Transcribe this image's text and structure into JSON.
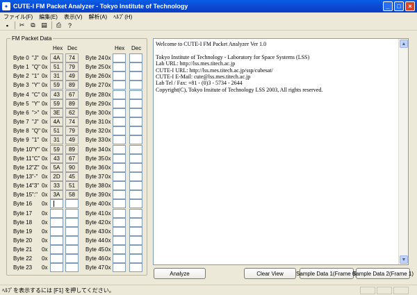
{
  "window": {
    "title": "CUTE-I FM Packet Analyzer - Tokyo Institute of Technology",
    "app_icon": "satellite-icon",
    "minimize": "_",
    "maximize": "□",
    "close": "×"
  },
  "menu": [
    "ファイル(F)",
    "編集(E)",
    "表示(V)",
    "解析(A)",
    "ﾍﾙﾌﾟ(H)"
  ],
  "toolbar": {
    "icons": [
      "save-icon",
      "cut-icon",
      "copy-icon",
      "paste-icon",
      "print-icon",
      "help-icon"
    ],
    "glyphs": [
      "▪",
      "✂",
      "⧉",
      "▤",
      "⎙",
      "?"
    ]
  },
  "packet_group": {
    "label": "FM Packet Data",
    "hex_header": "Hex",
    "dec_header": "Dec",
    "ox": "0x",
    "left_rows": [
      {
        "label": "Byte 0",
        "ch": "\"J\"",
        "hex": "4A",
        "dec": "74"
      },
      {
        "label": "Byte 1",
        "ch": "\"Q\"",
        "hex": "51",
        "dec": "79"
      },
      {
        "label": "Byte 2",
        "ch": "\"1\"",
        "hex": "31",
        "dec": "49"
      },
      {
        "label": "Byte 3",
        "ch": "\"Y\"",
        "hex": "59",
        "dec": "89"
      },
      {
        "label": "Byte 4",
        "ch": "\"C\"",
        "hex": "43",
        "dec": "67"
      },
      {
        "label": "Byte 5",
        "ch": "\"Y\"",
        "hex": "59",
        "dec": "89"
      },
      {
        "label": "Byte 6",
        "ch": "\">\"",
        "hex": "3E",
        "dec": "62"
      },
      {
        "label": "Byte 7",
        "ch": "\"J\"",
        "hex": "4A",
        "dec": "74"
      },
      {
        "label": "Byte 8",
        "ch": "\"Q\"",
        "hex": "51",
        "dec": "79"
      },
      {
        "label": "Byte 9",
        "ch": "\"1\"",
        "hex": "31",
        "dec": "49"
      },
      {
        "label": "Byte 10",
        "ch": "\"Y\"",
        "hex": "59",
        "dec": "89"
      },
      {
        "label": "Byte 11",
        "ch": "\"C\"",
        "hex": "43",
        "dec": "67"
      },
      {
        "label": "Byte 12",
        "ch": "\"Z\"",
        "hex": "5A",
        "dec": "90"
      },
      {
        "label": "Byte 13",
        "ch": "\"-\"",
        "hex": "2D",
        "dec": "45"
      },
      {
        "label": "Byte 14",
        "ch": "\"3\"",
        "hex": "33",
        "dec": "51"
      },
      {
        "label": "Byte 15",
        "ch": "\":\"",
        "hex": "3A",
        "dec": "58"
      },
      {
        "label": "Byte 16",
        "ch": "",
        "hex": "",
        "dec": ""
      },
      {
        "label": "Byte 17",
        "ch": "",
        "hex": "",
        "dec": ""
      },
      {
        "label": "Byte 18",
        "ch": "",
        "hex": "",
        "dec": ""
      },
      {
        "label": "Byte 19",
        "ch": "",
        "hex": "",
        "dec": ""
      },
      {
        "label": "Byte 20",
        "ch": "",
        "hex": "",
        "dec": ""
      },
      {
        "label": "Byte 21",
        "ch": "",
        "hex": "",
        "dec": ""
      },
      {
        "label": "Byte 22",
        "ch": "",
        "hex": "",
        "dec": ""
      },
      {
        "label": "Byte 23",
        "ch": "",
        "hex": "",
        "dec": ""
      }
    ],
    "right_rows": [
      {
        "label": "Byte 24",
        "hex": "",
        "dec": ""
      },
      {
        "label": "Byte 25",
        "hex": "",
        "dec": ""
      },
      {
        "label": "Byte 26",
        "hex": "",
        "dec": ""
      },
      {
        "label": "Byte 27",
        "hex": "",
        "dec": ""
      },
      {
        "label": "Byte 28",
        "hex": "",
        "dec": ""
      },
      {
        "label": "Byte 29",
        "hex": "",
        "dec": ""
      },
      {
        "label": "Byte 30",
        "hex": "",
        "dec": ""
      },
      {
        "label": "Byte 31",
        "hex": "",
        "dec": ""
      },
      {
        "label": "Byte 32",
        "hex": "",
        "dec": ""
      },
      {
        "label": "Byte 33",
        "hex": "",
        "dec": ""
      },
      {
        "label": "Byte 34",
        "hex": "",
        "dec": ""
      },
      {
        "label": "Byte 35",
        "hex": "",
        "dec": ""
      },
      {
        "label": "Byte 36",
        "hex": "",
        "dec": ""
      },
      {
        "label": "Byte 37",
        "hex": "",
        "dec": ""
      },
      {
        "label": "Byte 38",
        "hex": "",
        "dec": ""
      },
      {
        "label": "Byte 39",
        "hex": "",
        "dec": ""
      },
      {
        "label": "Byte 40",
        "hex": "",
        "dec": ""
      },
      {
        "label": "Byte 41",
        "hex": "",
        "dec": ""
      },
      {
        "label": "Byte 42",
        "hex": "",
        "dec": ""
      },
      {
        "label": "Byte 43",
        "hex": "",
        "dec": ""
      },
      {
        "label": "Byte 44",
        "hex": "",
        "dec": ""
      },
      {
        "label": "Byte 45",
        "hex": "",
        "dec": ""
      },
      {
        "label": "Byte 46",
        "hex": "",
        "dec": ""
      },
      {
        "label": "Byte 47",
        "hex": "",
        "dec": ""
      }
    ]
  },
  "log": {
    "lines": [
      "Welcome to CUTE-I FM Packet Analyzer Ver 1.0",
      "",
      "Tokyo Institute of Technology - Laboratory for Space Systems (LSS)",
      "Lab URL: http://lss.mes.titech.ac.jp",
      "CUTE-I URL: http://lss.mes.titech.ac.jp/ssp/cubesat/",
      "CUTE-I E-Mail: cute@lss.mes.titech.ac.jp",
      "Lab Tel / Fax: +81 - (0)3 - 5734 - 2644",
      "Copyright(C), Tokyo Insitute of Technology LSS 2003, All rights reserved."
    ],
    "scroll_up": "▲",
    "scroll_down": "▼"
  },
  "buttons": {
    "analyze": "Analyze",
    "clear": "Clear View",
    "sample1": "Sample Data 1(Frame 0)",
    "sample2": "Sample Data 2(Frame 1)"
  },
  "status": {
    "text": "ﾍﾙﾌﾟを表示するには [F1] を押してください。"
  }
}
